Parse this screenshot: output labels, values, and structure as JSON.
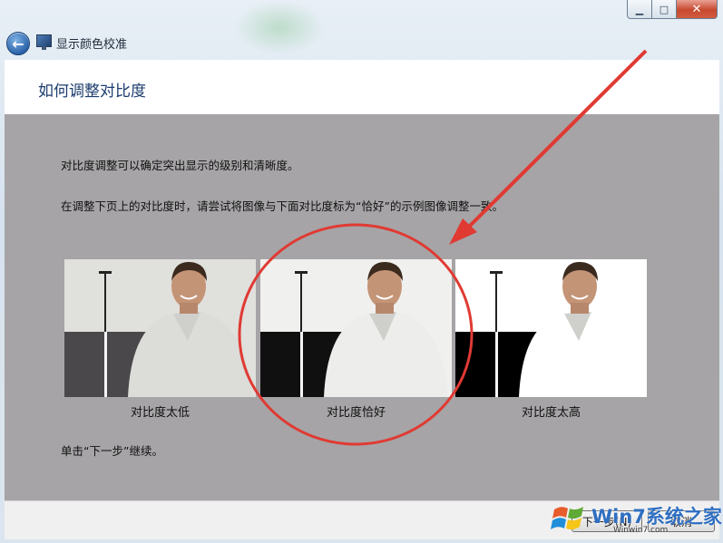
{
  "window": {
    "title": "显示颜色校准",
    "controls": {
      "minimize": "▁",
      "maximize": "□",
      "close": "✕"
    }
  },
  "nav": {
    "back_icon": "arrow-left-icon"
  },
  "page": {
    "heading": "如何调整对比度",
    "paragraph1": "对比度调整可以确定突出显示的级别和清晰度。",
    "paragraph2": "在调整下页上的对比度时，请尝试将图像与下面对比度标为“恰好”的示例图像调整一致。",
    "instruction": "单击“下一步”继续。"
  },
  "samples": [
    {
      "caption": "对比度太低",
      "bg": "#4a484b",
      "wall": "#e0e0dc",
      "shirt": "#dcdcd8"
    },
    {
      "caption": "对比度恰好",
      "bg": "#111011",
      "wall": "#f0f0ee",
      "shirt": "#ededeb"
    },
    {
      "caption": "对比度太高",
      "bg": "#000000",
      "wall": "#ffffff",
      "shirt": "#ffffff"
    }
  ],
  "footer": {
    "next_label": "下一步(N)",
    "cancel_label": "取消"
  },
  "annotation": {
    "circle_color": "#e03a33",
    "arrow_color": "#e03a33"
  },
  "watermark": {
    "brand": "Win7系统之家",
    "url": "Winwin7.com"
  }
}
